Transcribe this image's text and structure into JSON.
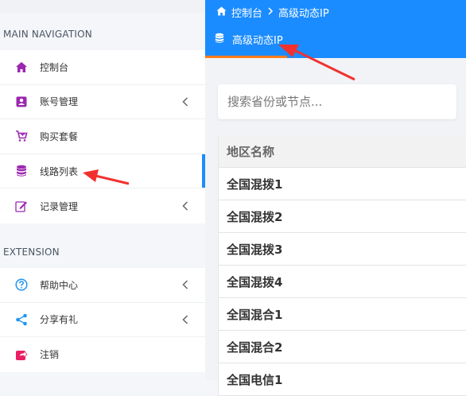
{
  "sidebar": {
    "sections": [
      {
        "title": "MAIN NAVIGATION",
        "items": [
          {
            "label": "控制台",
            "icon": "home-icon"
          },
          {
            "label": "账号管理",
            "icon": "user-card-icon",
            "chevron": true
          },
          {
            "label": "购买套餐",
            "icon": "cart-icon"
          },
          {
            "label": "线路列表",
            "icon": "database-icon",
            "active": true
          },
          {
            "label": "记录管理",
            "icon": "edit-icon",
            "chevron": true
          }
        ]
      },
      {
        "title": "EXTENSION",
        "items": [
          {
            "label": "帮助中心",
            "icon": "question-icon",
            "chevron": true
          },
          {
            "label": "分享有礼",
            "icon": "share-icon",
            "chevron": true
          },
          {
            "label": "注销",
            "icon": "logout-icon"
          }
        ]
      }
    ]
  },
  "header": {
    "breadcrumb": {
      "home": "控制台",
      "current": "高级动态IP"
    },
    "tab": {
      "label": "高级动态IP"
    }
  },
  "search": {
    "placeholder": "搜索省份或节点..."
  },
  "table": {
    "header": "地区名称",
    "rows": [
      "全国混拨1",
      "全国混拨2",
      "全国混拨3",
      "全国混拨4",
      "全国混合1",
      "全国混合2",
      "全国电信1"
    ]
  },
  "colors": {
    "accent": "#1a8cff",
    "icon_purple": "#9c27b0",
    "tab_underline": "#ff7b1c",
    "annotation_arrow": "#f2312f"
  }
}
